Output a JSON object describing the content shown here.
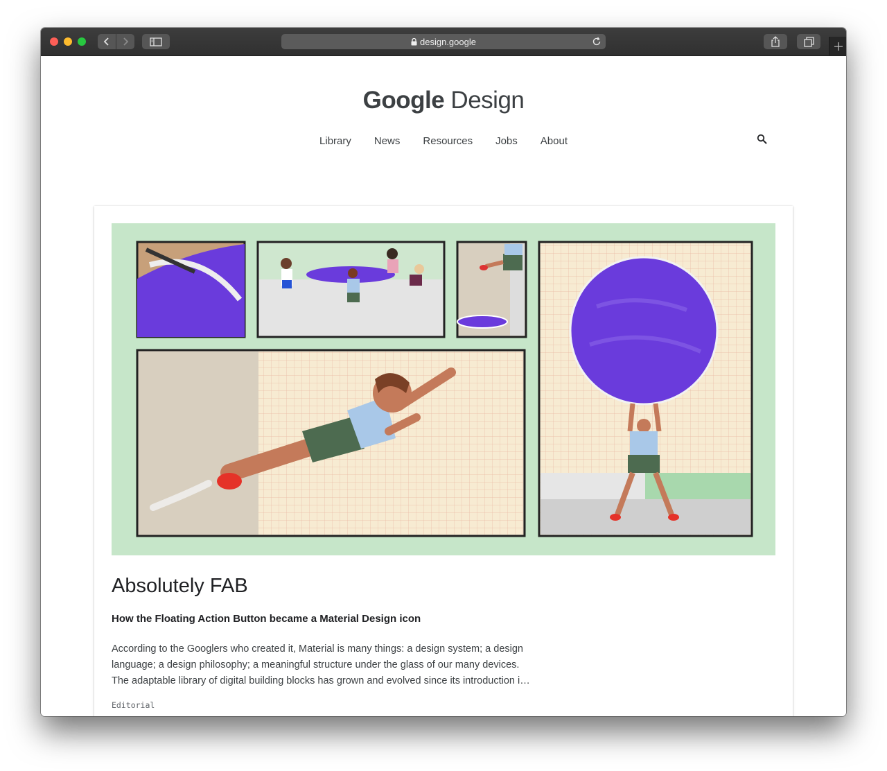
{
  "browser": {
    "address": "design.google",
    "icons": [
      "back-icon",
      "forward-icon",
      "sidebar-icon",
      "lock-icon",
      "reload-icon",
      "share-icon",
      "tabs-icon",
      "plus-icon"
    ]
  },
  "site": {
    "logo_google": "Google",
    "logo_design": "Design",
    "nav": [
      "Library",
      "News",
      "Resources",
      "Jobs",
      "About"
    ]
  },
  "article": {
    "title": "Absolutely FAB",
    "subtitle": "How the Floating Action Button became a Material Design icon",
    "excerpt_lines": [
      "According to the Googlers who created it, Material is many things: a design system; a design",
      "language; a design philosophy; a meaningful structure under the glass of our many devices.",
      "The adaptable library of digital building blocks has grown and evolved since its introduction i…"
    ],
    "tag": "Editorial"
  },
  "colors": {
    "hero_bg": "#c6e6c9",
    "purple": "#6a3bdc",
    "grid_paper": "#f7ebd2",
    "wall": "#d8cfbf"
  }
}
